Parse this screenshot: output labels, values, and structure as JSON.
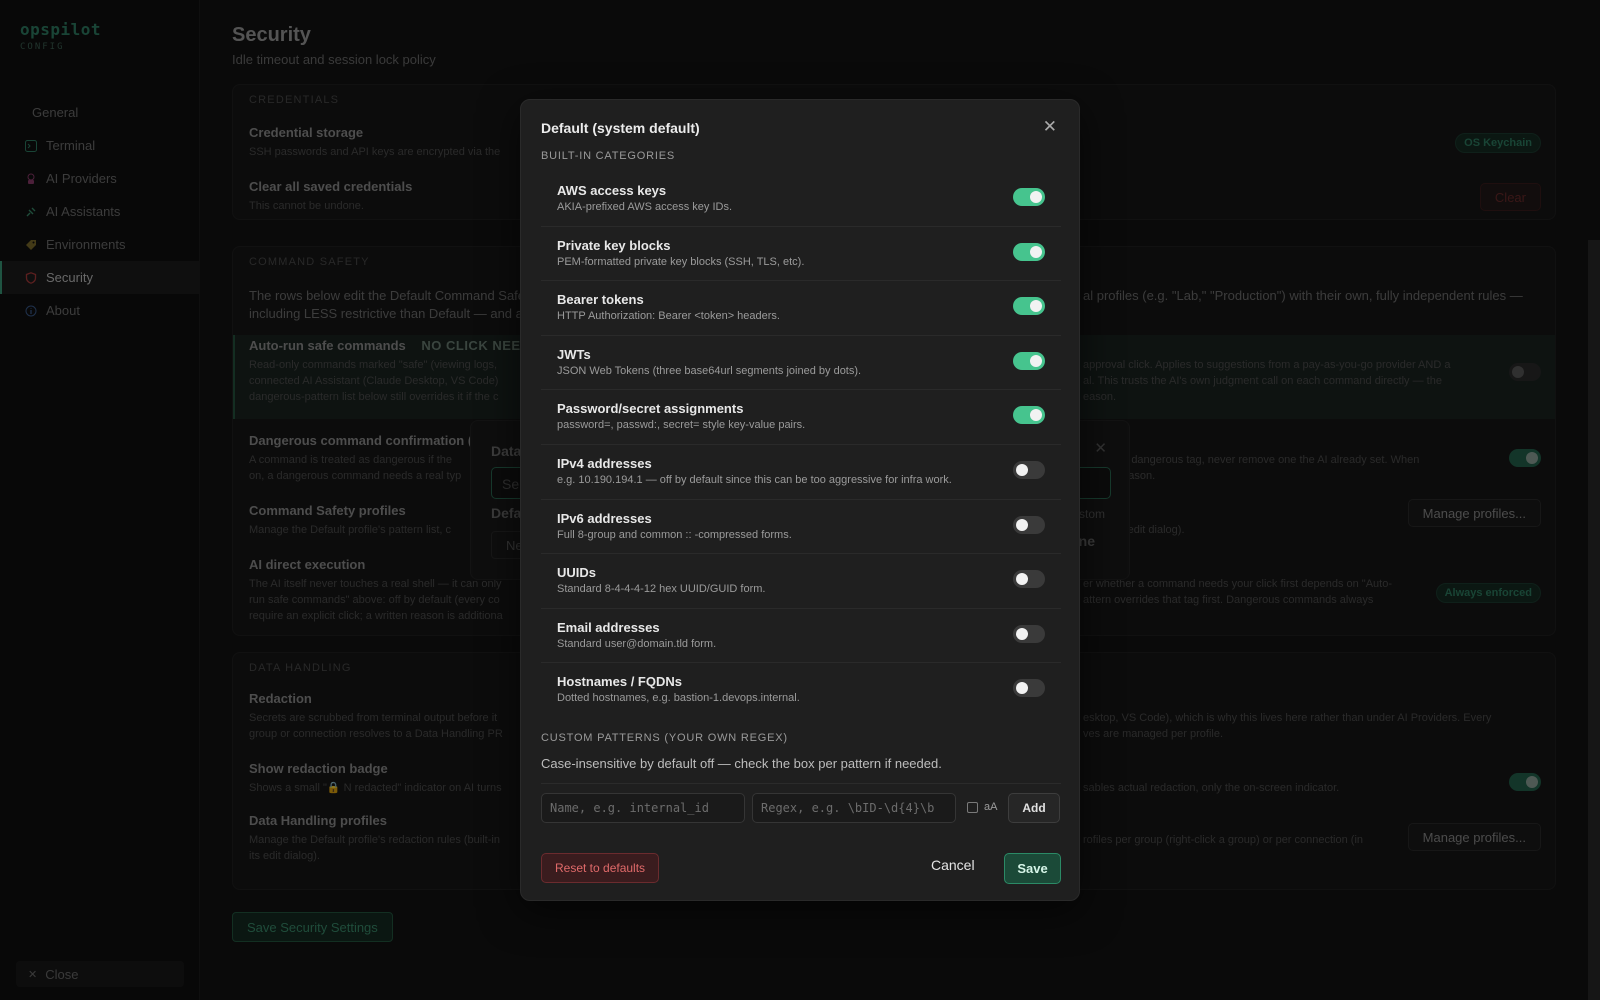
{
  "brand": {
    "name": "opspilot",
    "sub": "CONFIG"
  },
  "sidebar": {
    "items": [
      {
        "label": "General"
      },
      {
        "label": "Terminal"
      },
      {
        "label": "AI Providers"
      },
      {
        "label": "AI Assistants"
      },
      {
        "label": "Environments"
      },
      {
        "label": "Security"
      },
      {
        "label": "About"
      }
    ],
    "close_label": "Close"
  },
  "page": {
    "title": "Security",
    "subtitle": "Idle timeout and session lock policy",
    "save_label": "Save Security Settings"
  },
  "credentials": {
    "heading": "CREDENTIALS",
    "storage_title": "Credential storage",
    "storage_desc": "SSH passwords and API keys are encrypted via the",
    "storage_badge": "OS Keychain",
    "clear_title": "Clear all saved credentials",
    "clear_desc": "This cannot be undone.",
    "clear_button": "Clear"
  },
  "command_safety": {
    "heading": "COMMAND SAFETY",
    "intro_1": "The rows below edit the Default Command Safe",
    "intro_1b": "al profiles (e.g. \"Lab,\" \"Production\") with their own, fully independent rules —",
    "intro_2": "including LESS restrictive than Default — and as",
    "autorun_title": "Auto-run safe commands",
    "autorun_tag": "NO CLICK NEEDED",
    "autorun_desc_1": "Read-only commands marked \"safe\" (viewing logs,",
    "autorun_desc_1b": "approval click. Applies to suggestions from a pay-as-you-go provider AND a",
    "autorun_desc_2": "connected AI Assistant (Claude Desktop, VS Code)",
    "autorun_desc_2b": "al. This trusts the AI's own judgment call on each command directly — the",
    "autorun_desc_3": "dangerous-pattern list below still overrides it if the c",
    "autorun_desc_3b": "eason.",
    "danger_title": "Dangerous command confirmation (D",
    "danger_desc_1": "A command is treated as dangerous if the",
    "danger_desc_1b": "y add the dangerous tag, never remove one the AI already set. When",
    "danger_desc_2": "on, a dangerous command needs a real typ",
    "danger_desc_2b": "written reason.",
    "profiles_title": "Command Safety profiles",
    "profiles_desc": "Manage the Default profile's pattern list, c",
    "profiles_desc_b": "on (in its edit dialog).",
    "profiles_button": "Manage profiles...",
    "direct_title": "AI direct execution",
    "direct_desc_1": "The AI itself never touches a real shell — it can only",
    "direct_desc_1b": "er whether a command needs your click first depends on \"Auto-",
    "direct_desc_2": "run safe commands\" above: off by default (every co",
    "direct_desc_2b": "attern overrides that tag first. Dangerous commands always",
    "direct_desc_3": "require an explicit click; a written reason is additiona",
    "direct_badge": "Always enforced"
  },
  "data_handling": {
    "heading": "DATA HANDLING",
    "redaction_title": "Redaction",
    "redaction_desc_1": "Secrets are scrubbed from terminal output before it",
    "redaction_desc_1b": "esktop, VS Code), which is why this lives here rather than under AI Providers. Every",
    "redaction_desc_2": "group or connection resolves to a Data Handling PR",
    "redaction_desc_2b": "ves are managed per profile.",
    "badge_title": "Show redaction badge",
    "badge_desc": "Shows a small \"🔒 N redacted\" indicator on AI turns",
    "badge_desc_b": "sables actual redaction, only the on-screen indicator.",
    "profiles_title": "Data Handling profiles",
    "profiles_desc_1": "Manage the Default profile's redaction rules (built-in",
    "profiles_desc_1b": "rofiles per group (right-click a group) or per connection (in",
    "profiles_desc_2": "its edit dialog).",
    "profiles_button": "Manage profiles..."
  },
  "back_modal": {
    "title": "Data",
    "search_placeholder": "Se",
    "default_label": "Defa",
    "default_right": "ustom",
    "none_label": "ne",
    "button_label": "Ne"
  },
  "modal": {
    "title": "Default (system default)",
    "builtin_heading": "BUILT-IN CATEGORIES",
    "categories": [
      {
        "name": "AWS access keys",
        "desc": "AKIA-prefixed AWS access key IDs.",
        "enabled": true
      },
      {
        "name": "Private key blocks",
        "desc": "PEM-formatted private key blocks (SSH, TLS, etc).",
        "enabled": true
      },
      {
        "name": "Bearer tokens",
        "desc": "HTTP Authorization: Bearer <token> headers.",
        "enabled": true
      },
      {
        "name": "JWTs",
        "desc": "JSON Web Tokens (three base64url segments joined by dots).",
        "enabled": true
      },
      {
        "name": "Password/secret assignments",
        "desc": "password=, passwd:, secret= style key-value pairs.",
        "enabled": true
      },
      {
        "name": "IPv4 addresses",
        "desc": "e.g. 10.190.194.1 — off by default since this can be too aggressive for infra work.",
        "enabled": false
      },
      {
        "name": "IPv6 addresses",
        "desc": "Full 8-group and common :: -compressed forms.",
        "enabled": false
      },
      {
        "name": "UUIDs",
        "desc": "Standard 8-4-4-4-12 hex UUID/GUID form.",
        "enabled": false
      },
      {
        "name": "Email addresses",
        "desc": "Standard user@domain.tld form.",
        "enabled": false
      },
      {
        "name": "Hostnames / FQDNs",
        "desc": "Dotted hostnames, e.g. bastion-1.devops.internal.",
        "enabled": false
      }
    ],
    "custom_heading": "CUSTOM PATTERNS (YOUR OWN REGEX)",
    "custom_hint": "Case-insensitive by default off — check the box per pattern if needed.",
    "name_placeholder": "Name, e.g. internal_id",
    "regex_placeholder": "Regex, e.g. \\bID-\\d{4}\\b",
    "case_label": "aA",
    "add_label": "Add",
    "reset_label": "Reset to defaults",
    "cancel_label": "Cancel",
    "save_label": "Save"
  },
  "colors": {
    "accent": "#46c48e",
    "danger": "#e06a6a",
    "modal_bg": "#1f1f1f"
  }
}
